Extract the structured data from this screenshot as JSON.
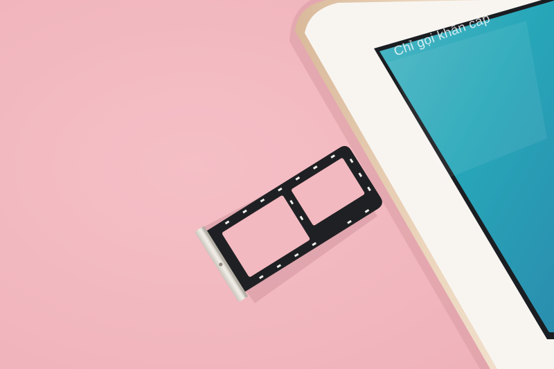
{
  "scene": {
    "background_color": "#f3b9c0",
    "phone": {
      "body_color": "#f7f3ee",
      "frame_color": "#e2c6a6",
      "screen_color": "#2da6b8",
      "lock_screen_text": "Chỉ gọi khẩn cấp"
    },
    "sim_tray": {
      "tray_color": "#232427",
      "pin_color": "#f0f0ec",
      "handle_color": "#dedbd4"
    }
  }
}
